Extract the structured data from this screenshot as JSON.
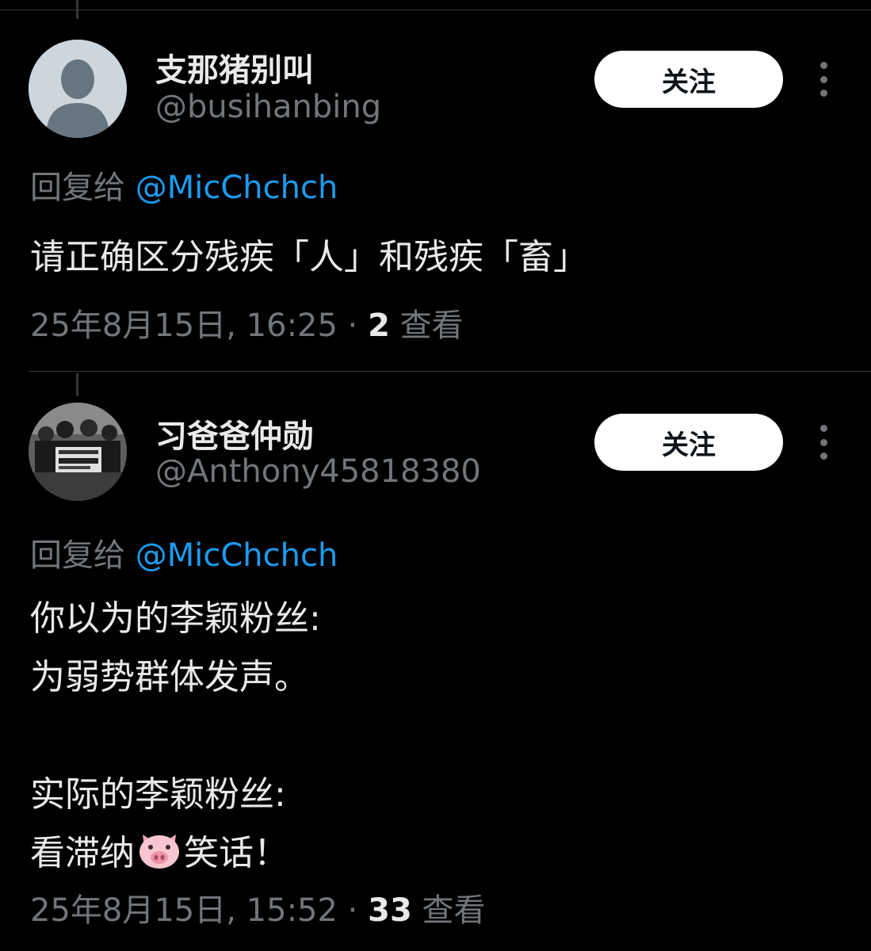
{
  "tweets": [
    {
      "display_name": "支那猪别叫",
      "handle": "@busihanbing",
      "follow_label": "关注",
      "reply_prefix": "回复给",
      "reply_to": "@MicChchch",
      "body_lines": [
        "请正确区分残疾「人」和残疾「畜」"
      ],
      "timestamp": "25年8月15日, 16:25",
      "separator": " · ",
      "views_count": "2",
      "views_label": " 查看",
      "avatar_icon": "default-avatar-icon"
    },
    {
      "display_name": "习爸爸仲勋",
      "handle": "@Anthony45818380",
      "follow_label": "关注",
      "reply_prefix": "回复给",
      "reply_to": "@MicChchch",
      "body_lines": [
        "你以为的李颖粉丝:",
        "为弱势群体发声。",
        "",
        "实际的李颖粉丝:"
      ],
      "body_last_before": "看滞纳",
      "body_last_after": "笑话！",
      "timestamp": "25年8月15日, 15:52",
      "separator": " · ",
      "views_count": "33",
      "views_label": " 查看",
      "avatar_icon": "photo-avatar-icon"
    }
  ],
  "colors": {
    "background": "#000000",
    "text_primary": "#e7e9ea",
    "text_secondary": "#71767b",
    "link": "#1d9bf0",
    "button_bg": "#ffffff"
  },
  "icons": {
    "more": "more-vertical-icon",
    "emoji": "pig-face-emoji-icon"
  }
}
